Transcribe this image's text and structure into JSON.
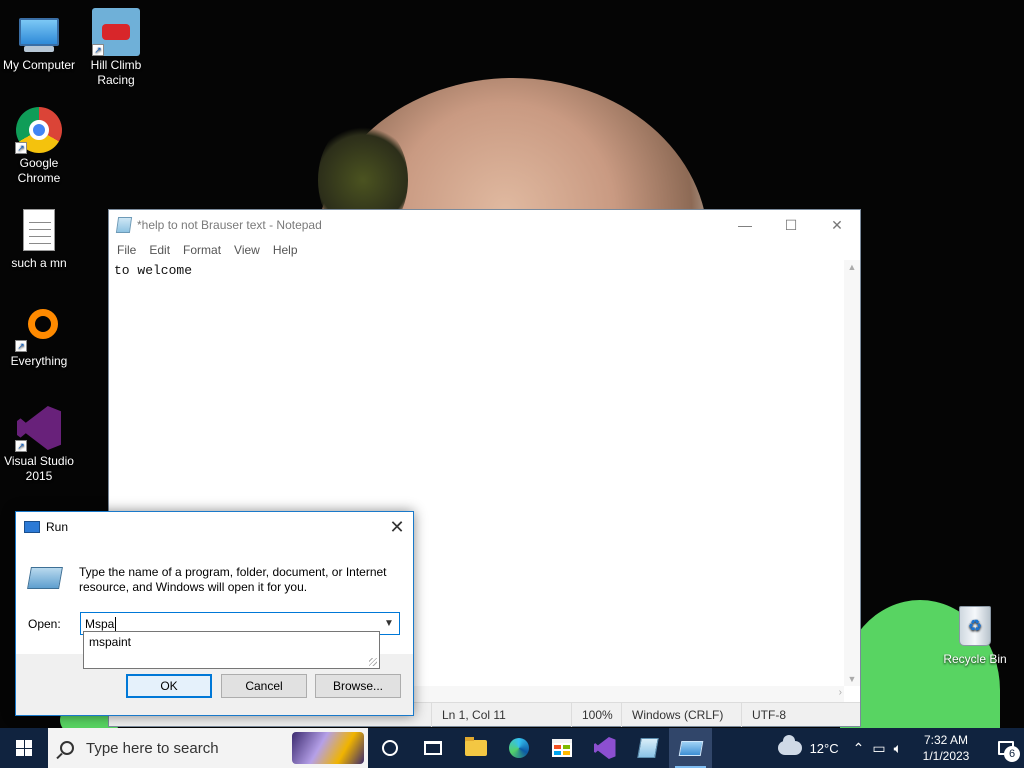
{
  "desktop": {
    "icons": [
      {
        "label": "My Computer"
      },
      {
        "label": "Hill Climb Racing"
      },
      {
        "label": "Google Chrome"
      },
      {
        "label": "such a mn"
      },
      {
        "label": "Everything"
      },
      {
        "label": "Visual Studio 2015"
      },
      {
        "label": "Recycle Bin"
      }
    ]
  },
  "notepad": {
    "title": "*help to not Brauser text - Notepad",
    "menu": [
      "File",
      "Edit",
      "Format",
      "View",
      "Help"
    ],
    "content": "to welcome",
    "status": {
      "position": "Ln 1, Col 11",
      "zoom": "100%",
      "line_endings": "Windows (CRLF)",
      "encoding": "UTF-8"
    }
  },
  "run_dialog": {
    "title": "Run",
    "description": "Type the name of a program, folder, document, or Internet resource, and Windows will open it for you.",
    "open_label": "Open:",
    "open_value": "Mspa",
    "suggestion": "mspaint",
    "ok_label": "OK",
    "cancel_label": "Cancel",
    "browse_label": "Browse..."
  },
  "taskbar": {
    "search_placeholder": "Type here to search",
    "weather": "12°C",
    "time": "7:32 AM",
    "date": "1/1/2023",
    "notification_count": "6"
  }
}
